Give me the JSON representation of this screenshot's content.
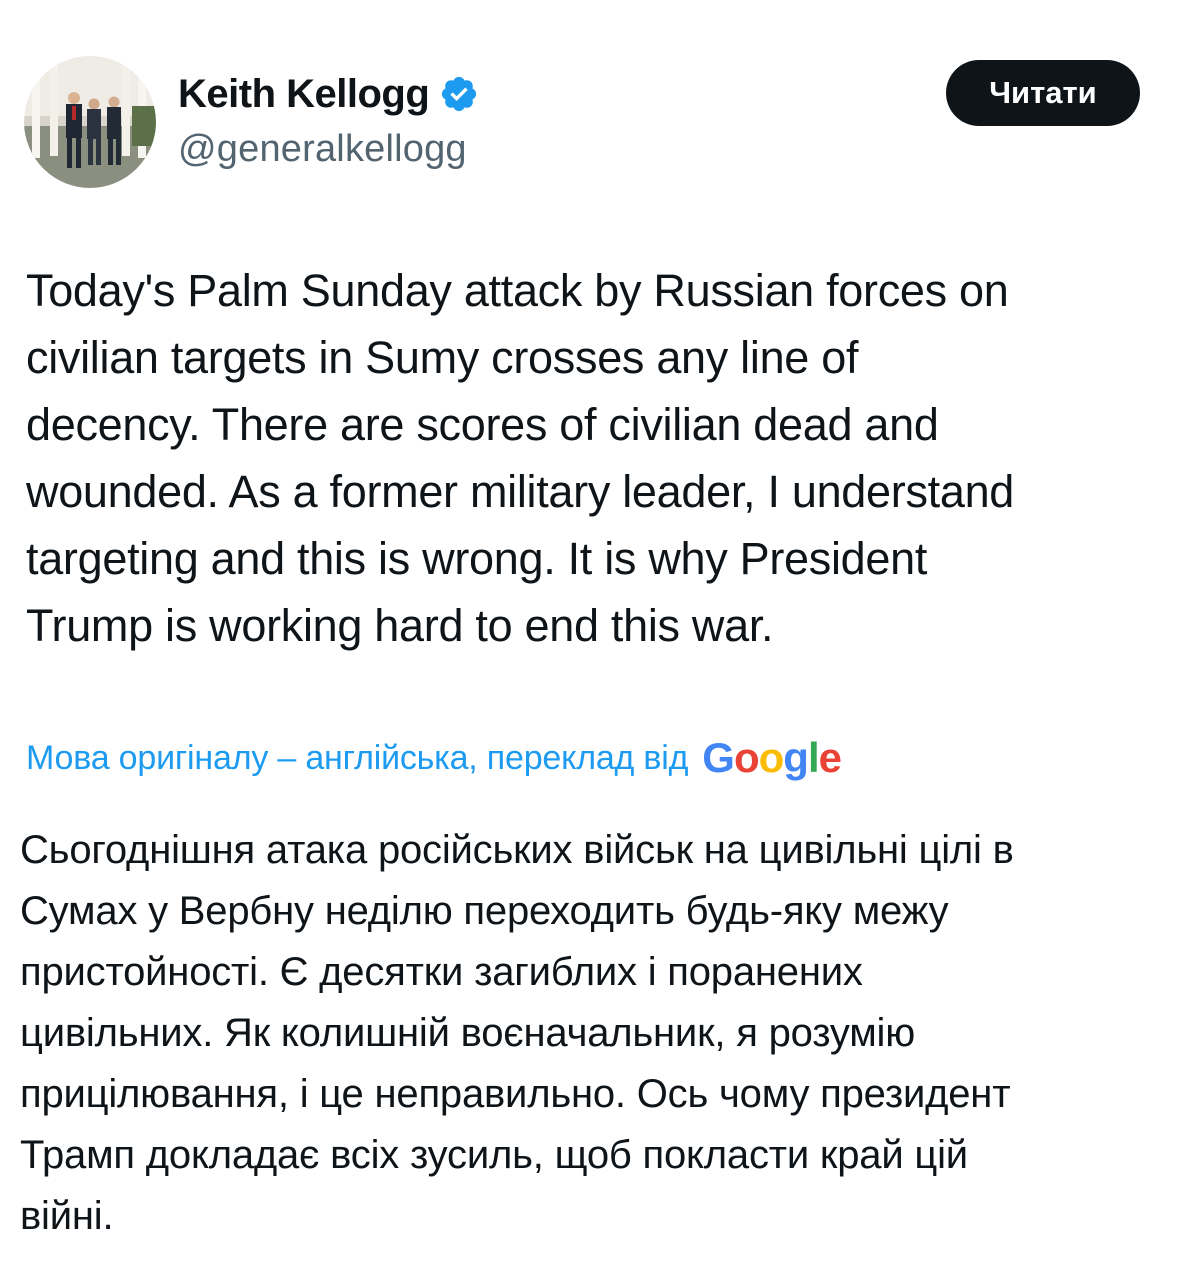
{
  "author": {
    "display_name": "Keith Kellogg",
    "handle": "@generalkellogg",
    "avatar_icon": "avatar-photo",
    "verified_icon": "verified-badge-icon",
    "verified_color": "#1d9bf0"
  },
  "follow_button": {
    "label": "Читати",
    "background": "#0f1419",
    "text_color": "#ffffff"
  },
  "tweet": {
    "text": "Today's Palm Sunday attack by Russian forces on\ncivilian targets in Sumy crosses any line of\ndecency.  There are scores of civilian dead and\nwounded. As a former military leader, I understand\ntargeting and this is wrong. It is why President\nTrump is working hard to end this war."
  },
  "translation": {
    "note": "Мова оригіналу – англійська, переклад від",
    "provider_logo": {
      "letters": [
        "G",
        "o",
        "o",
        "g",
        "l",
        "e"
      ]
    },
    "note_color": "#1d9bf0",
    "text": "Сьогоднішня атака російських військ на цивільні цілі в\nСумах у Вербну неділю переходить будь-яку межу\nпристойності. Є десятки загиблих і поранених\nцивільних. Як колишній воєначальник, я розумію\nприцілювання, і це неправильно. Ось чому президент\nТрамп докладає всіх зусиль, щоб покласти край цій\nвійні."
  }
}
